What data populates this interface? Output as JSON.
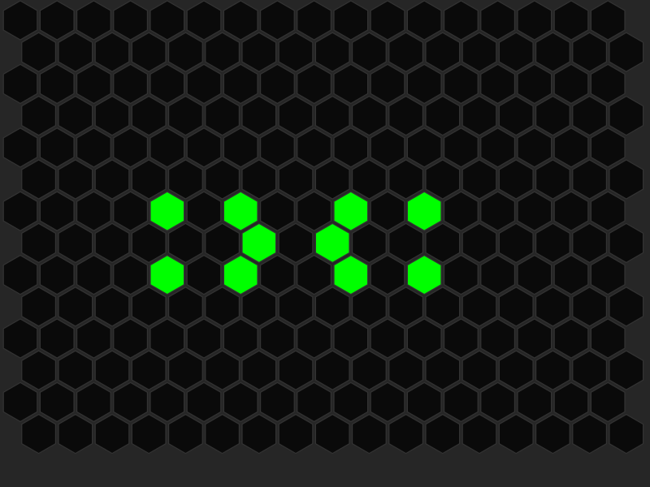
{
  "board": {
    "rows": 14,
    "cols": 17,
    "colors": {
      "background": "#262626",
      "cell_off": "#0a0a0a",
      "cell_on": "#00ff00",
      "cell_border": "#333333"
    },
    "active_cells": [
      [
        6,
        4
      ],
      [
        6,
        6
      ],
      [
        6,
        9
      ],
      [
        6,
        11
      ],
      [
        7,
        6
      ],
      [
        7,
        8
      ],
      [
        8,
        4
      ],
      [
        8,
        6
      ],
      [
        8,
        9
      ],
      [
        8,
        11
      ]
    ]
  }
}
